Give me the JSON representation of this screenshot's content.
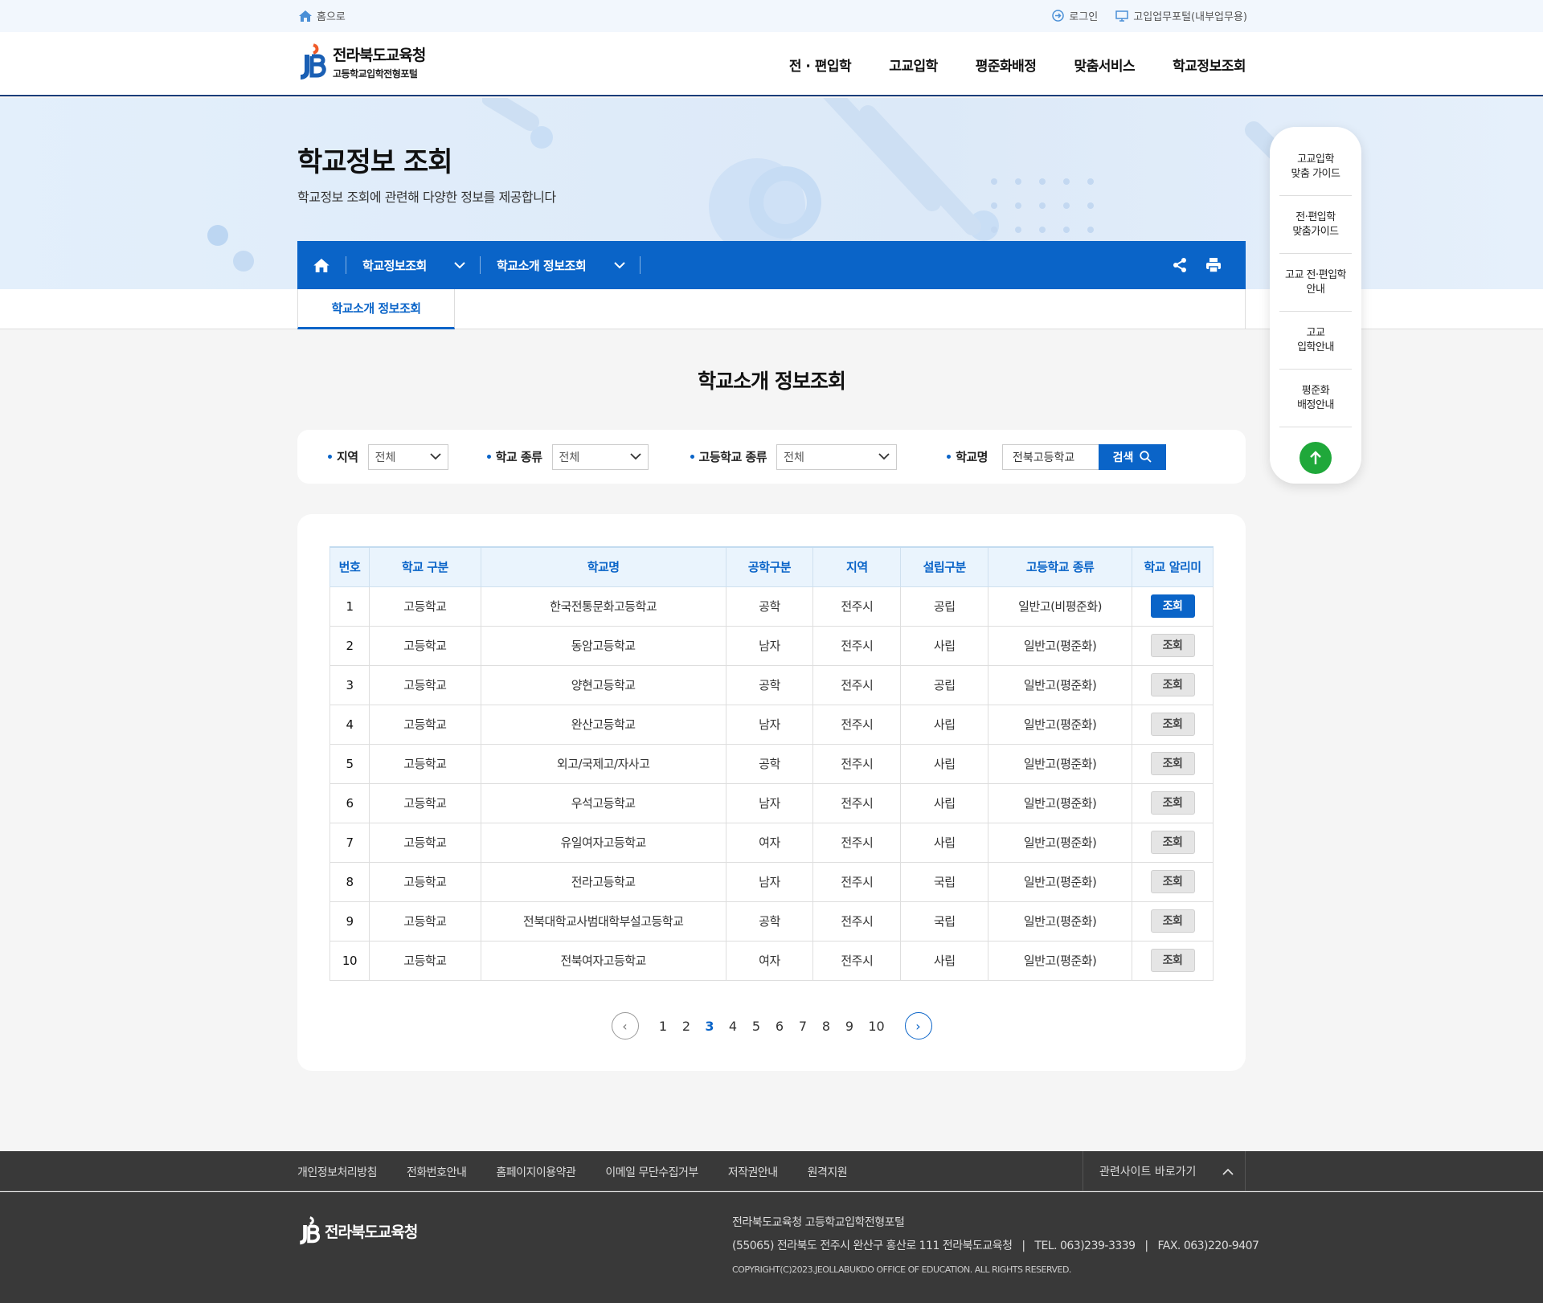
{
  "util": {
    "home": "홈으로",
    "login": "로그인",
    "portal": "고입업무포털(내부업무용)"
  },
  "header": {
    "logo_title": "전라북도교육청",
    "logo_sub": "고등학교입학전형포털",
    "gnb": [
      "전 · 편입학",
      "고교입학",
      "평준화배정",
      "맞춤서비스",
      "학교정보조회"
    ]
  },
  "visual": {
    "title": "학교정보 조회",
    "desc": "학교정보 조회에 관련해 다양한 정보를 제공합니다"
  },
  "lnb": {
    "dd1": "학교정보조회",
    "dd2": "학교소개 정보조회"
  },
  "tab": "학교소개 정보조회",
  "section_title": "학교소개 정보조회",
  "search": {
    "region_label": "지역",
    "region_value": "전체",
    "type_label": "학교 종류",
    "type_value": "전체",
    "hs_label": "고등학교 종류",
    "hs_value": "전체",
    "name_label": "학교명",
    "name_value": "전북고등학교",
    "button": "검색"
  },
  "table": {
    "headers": [
      "번호",
      "학교 구분",
      "학교명",
      "공학구분",
      "지역",
      "설립구분",
      "고등학교 종류",
      "학교 알리미"
    ],
    "button_label": "조회",
    "rows": [
      [
        "1",
        "고등학교",
        "한국전통문화고등학교",
        "공학",
        "전주시",
        "공립",
        "일반고(비평준화)"
      ],
      [
        "2",
        "고등학교",
        "동암고등학교",
        "남자",
        "전주시",
        "사립",
        "일반고(평준화)"
      ],
      [
        "3",
        "고등학교",
        "양현고등학교",
        "공학",
        "전주시",
        "공립",
        "일반고(평준화)"
      ],
      [
        "4",
        "고등학교",
        "완산고등학교",
        "남자",
        "전주시",
        "사립",
        "일반고(평준화)"
      ],
      [
        "5",
        "고등학교",
        "외고/국제고/자사고",
        "공학",
        "전주시",
        "사립",
        "일반고(평준화)"
      ],
      [
        "6",
        "고등학교",
        "우석고등학교",
        "남자",
        "전주시",
        "사립",
        "일반고(평준화)"
      ],
      [
        "7",
        "고등학교",
        "유일여자고등학교",
        "여자",
        "전주시",
        "사립",
        "일반고(평준화)"
      ],
      [
        "8",
        "고등학교",
        "전라고등학교",
        "남자",
        "전주시",
        "국립",
        "일반고(평준화)"
      ],
      [
        "9",
        "고등학교",
        "전북대학교사범대학부설고등학교",
        "공학",
        "전주시",
        "국립",
        "일반고(평준화)"
      ],
      [
        "10",
        "고등학교",
        "전북여자고등학교",
        "여자",
        "전주시",
        "사립",
        "일반고(평준화)"
      ]
    ]
  },
  "pagination": {
    "pages": [
      "1",
      "2",
      "3",
      "4",
      "5",
      "6",
      "7",
      "8",
      "9",
      "10"
    ],
    "current": "3",
    "prev": "‹",
    "next": "›"
  },
  "quick": {
    "items": [
      "고교입학\n맞춤 가이드",
      "전·편입학\n맞춤가이드",
      "고교 전·편입학\n안내",
      "고교\n입학안내",
      "평준화\n배정안내"
    ],
    "top": "↑"
  },
  "footer": {
    "links": [
      "개인정보처리방침",
      "전화번호안내",
      "홈페이지이용약관",
      "이메일 무단수집거부",
      "저작권안내",
      "원격지원"
    ],
    "related": "관련사이트 바로가기",
    "logo": "전라북도교육청",
    "org": "전라북도교육청 고등학교입학전형포털",
    "address": "(55065) 전라북도 전주시 완산구 홍산로 111 전라북도교육청   |   TEL. 063)239-3339   |   FAX. 063)220-9407",
    "copyright": "COPYRIGHT(C)2023.JEOLLABUKDO OFFICE OF EDUCATION. ALL RIGHTS RESERVED."
  },
  "colors": {
    "primary": "#0a64c8",
    "footer": "#393939",
    "top_button": "#1fa83a"
  }
}
